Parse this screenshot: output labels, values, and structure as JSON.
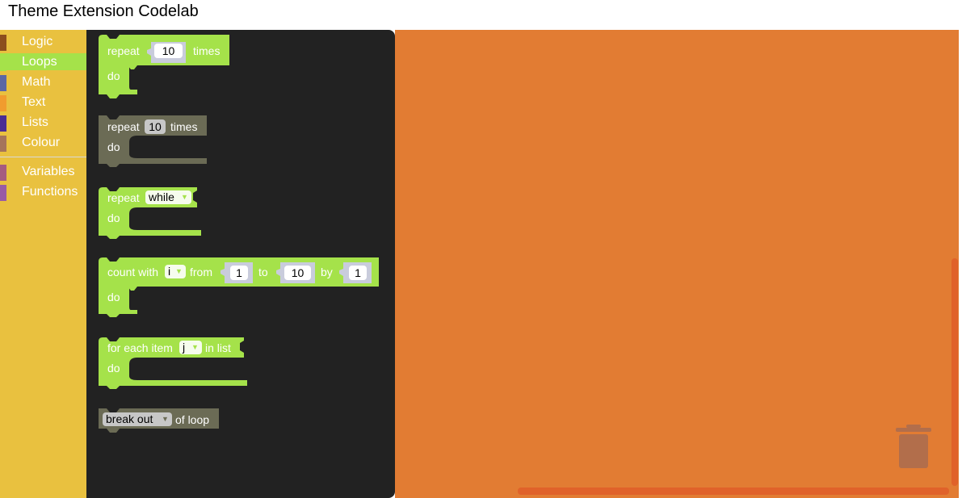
{
  "app": {
    "title": "Theme Extension Codelab"
  },
  "toolbox": {
    "categories": [
      {
        "label": "Logic",
        "color": "#8c4f1e"
      },
      {
        "label": "Loops",
        "color": "#a5e24a",
        "selected": true
      },
      {
        "label": "Math",
        "color": "#5b67a5"
      },
      {
        "label": "Text",
        "color": "#f19c2e"
      },
      {
        "label": "Lists",
        "color": "#4a2c94"
      },
      {
        "label": "Colour",
        "color": "#a5745b"
      },
      {
        "label": "Variables",
        "color": "#a55b80"
      },
      {
        "label": "Functions",
        "color": "#995ba5"
      }
    ]
  },
  "flyout": {
    "loop_color": "#a5e24a",
    "disabled_color": "#6b6b55",
    "blocks": {
      "repeat": {
        "label": "repeat",
        "value": "10",
        "suffix": "times",
        "do": "do"
      },
      "repeat_disabled": {
        "label": "repeat",
        "value": "10",
        "suffix": "times",
        "do": "do"
      },
      "repeat_while": {
        "label": "repeat",
        "mode": "while",
        "do": "do"
      },
      "count_with": {
        "label": "count with",
        "var": "i",
        "from_label": "from",
        "from": "1",
        "to_label": "to",
        "to": "10",
        "by_label": "by",
        "by": "1",
        "do": "do"
      },
      "for_each": {
        "label": "for each item",
        "var": "j",
        "suffix": "in list",
        "do": "do"
      },
      "break": {
        "mode": "break out",
        "suffix": "of loop"
      }
    }
  },
  "workspace": {
    "background": "#e27c33",
    "trash_icon": "trash-icon"
  }
}
